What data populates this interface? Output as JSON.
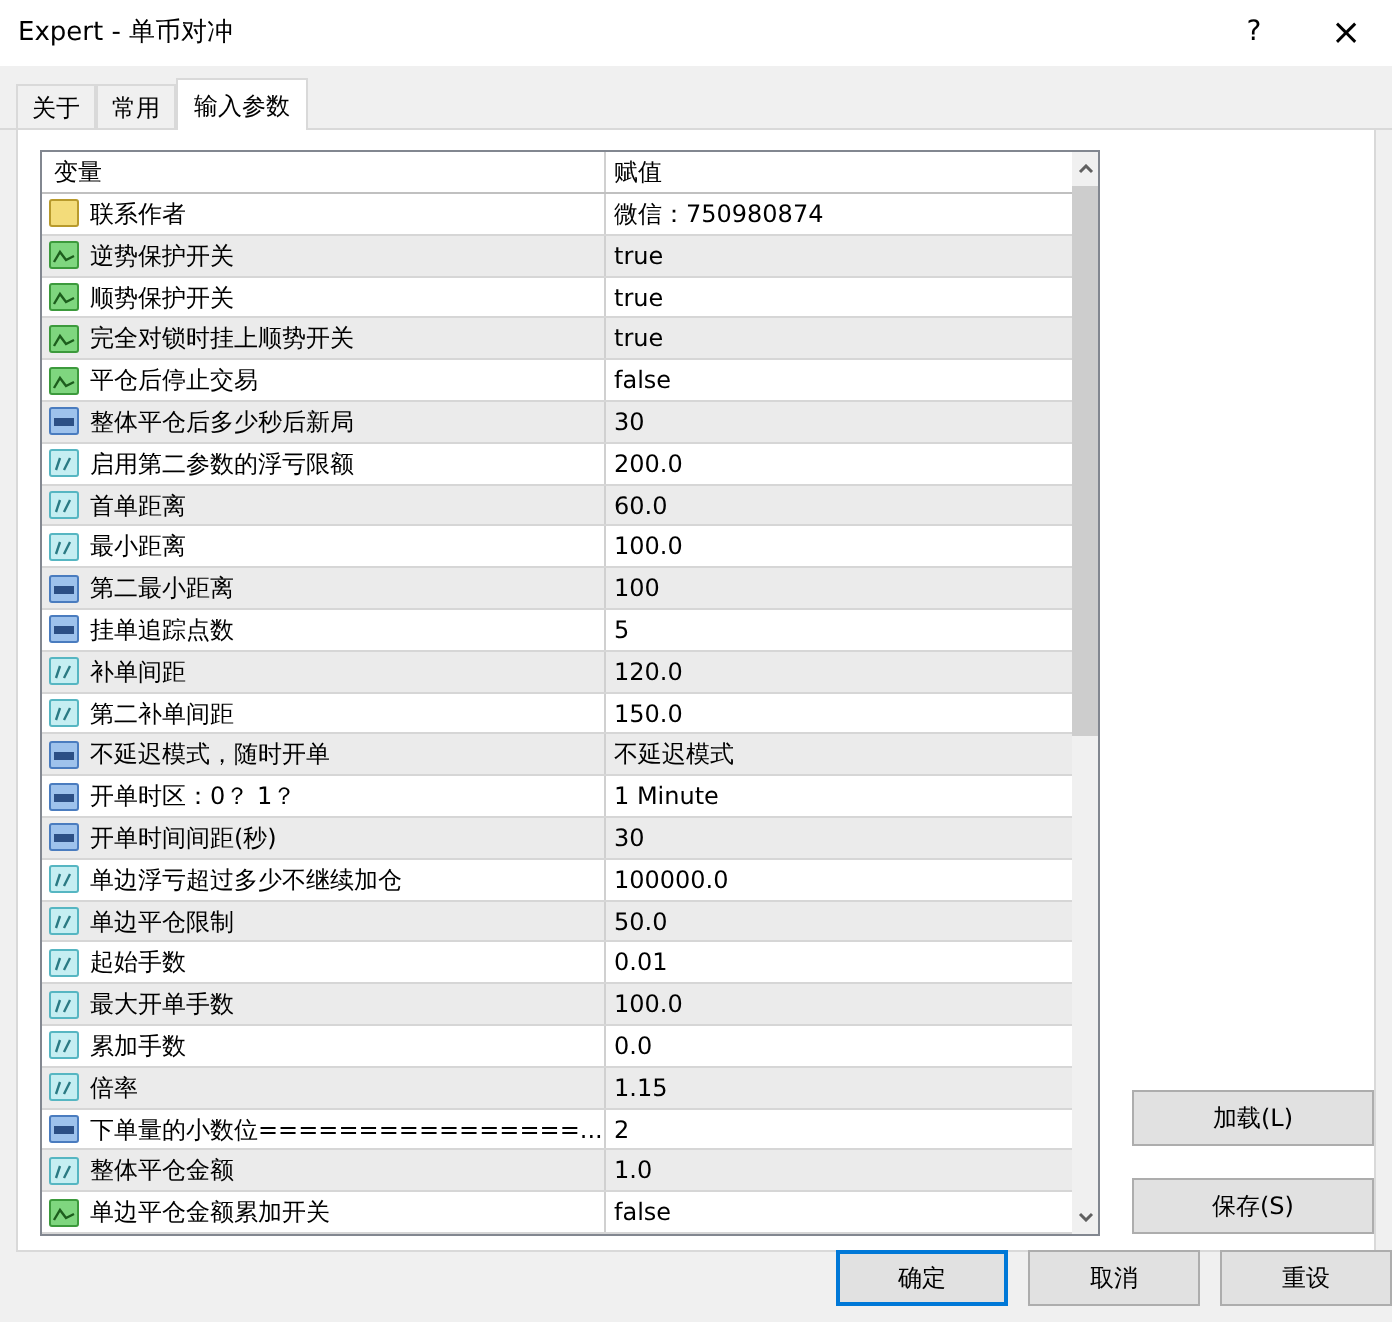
{
  "window": {
    "title": "Expert - 单币对冲",
    "help": "?",
    "close": "×"
  },
  "tabs": [
    {
      "label": "关于",
      "selected": false
    },
    {
      "label": "常用",
      "selected": false
    },
    {
      "label": "输入参数",
      "selected": true
    }
  ],
  "table": {
    "columns": [
      "变量",
      "赋值"
    ],
    "rows": [
      {
        "kind": "string",
        "name": "联系作者",
        "value": "微信：750980874"
      },
      {
        "kind": "bool",
        "name": "逆势保护开关",
        "value": "true"
      },
      {
        "kind": "bool",
        "name": "顺势保护开关",
        "value": "true"
      },
      {
        "kind": "bool",
        "name": "完全对锁时挂上顺势开关",
        "value": "true"
      },
      {
        "kind": "bool",
        "name": "平仓后停止交易",
        "value": "false"
      },
      {
        "kind": "int",
        "name": "整体平仓后多少秒后新局",
        "value": "30"
      },
      {
        "kind": "double",
        "name": "启用第二参数的浮亏限额",
        "value": "200.0"
      },
      {
        "kind": "double",
        "name": "首单距离",
        "value": "60.0"
      },
      {
        "kind": "double",
        "name": "最小距离",
        "value": "100.0"
      },
      {
        "kind": "int",
        "name": "第二最小距离",
        "value": "100"
      },
      {
        "kind": "int",
        "name": "挂单追踪点数",
        "value": "5"
      },
      {
        "kind": "double",
        "name": "补单间距",
        "value": "120.0"
      },
      {
        "kind": "double",
        "name": "第二补单间距",
        "value": "150.0"
      },
      {
        "kind": "int",
        "name": "不延迟模式，随时开单",
        "value": "不延迟模式"
      },
      {
        "kind": "int",
        "name": "开单时区：0？ 1？",
        "value": "1 Minute"
      },
      {
        "kind": "int",
        "name": "开单时间间距(秒)",
        "value": "30"
      },
      {
        "kind": "double",
        "name": "单边浮亏超过多少不继续加仓",
        "value": "100000.0"
      },
      {
        "kind": "double",
        "name": "单边平仓限制",
        "value": "50.0"
      },
      {
        "kind": "double",
        "name": "起始手数",
        "value": "0.01"
      },
      {
        "kind": "double",
        "name": "最大开单手数",
        "value": "100.0"
      },
      {
        "kind": "double",
        "name": "累加手数",
        "value": "0.0"
      },
      {
        "kind": "double",
        "name": "倍率",
        "value": "1.15"
      },
      {
        "kind": "int",
        "name": "下单量的小数位================...",
        "value": "2"
      },
      {
        "kind": "double",
        "name": "整体平仓金额",
        "value": "1.0"
      },
      {
        "kind": "bool",
        "name": "单边平仓金额累加开关",
        "value": "false"
      }
    ]
  },
  "side_buttons": [
    "加载(L)",
    "保存(S)"
  ],
  "buttons": [
    {
      "label": "确定",
      "selected": true
    },
    {
      "label": "取消",
      "selected": false
    },
    {
      "label": "重设",
      "selected": false
    }
  ]
}
